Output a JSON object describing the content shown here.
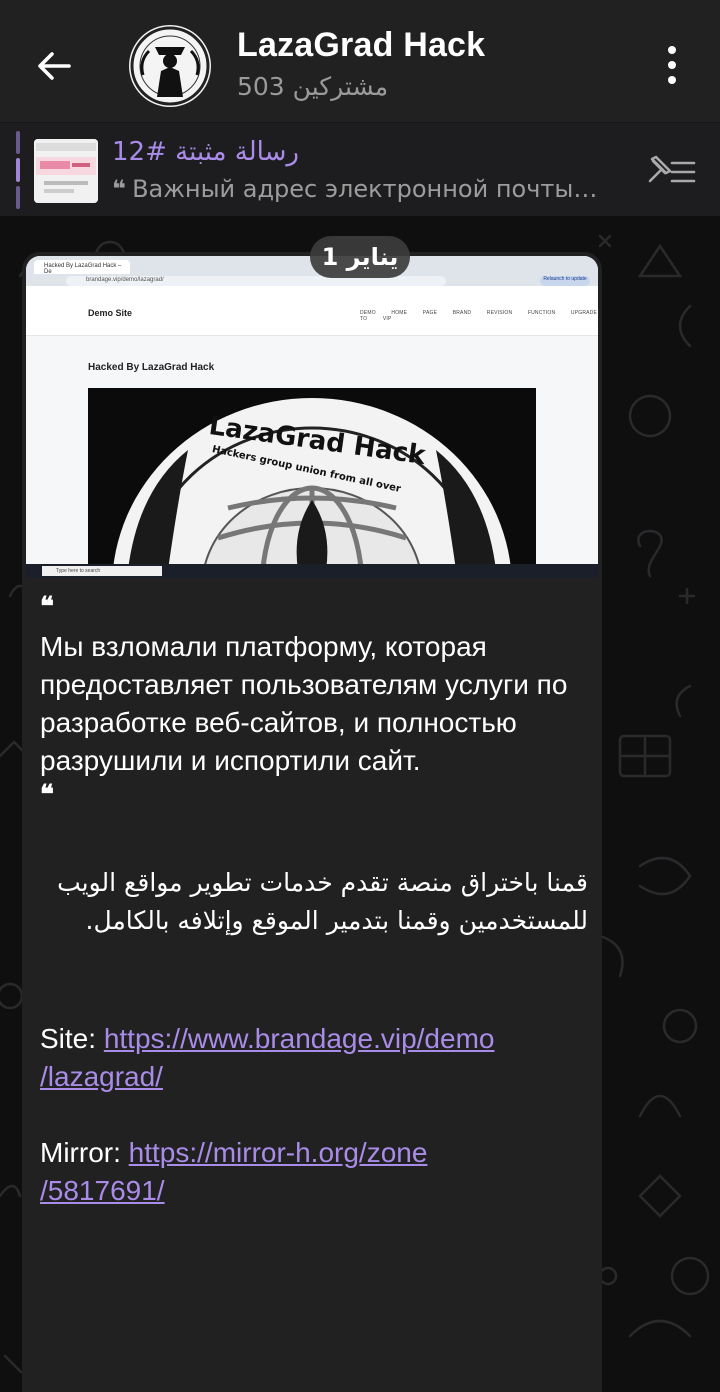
{
  "header": {
    "title": "LazaGrad Hack",
    "subscribers": "503 مشتركين"
  },
  "pinned": {
    "title": "رسالة مثبتة #12",
    "preview": "Важный адрес электронной почты…"
  },
  "date_pill": "1 يناير",
  "message": {
    "quote_open": "❝",
    "ru_text": "Мы взломали платформу, которая предоставляет пользователям услуги по разработке веб-сайтов, и полностью разрушили и испортили сайт.",
    "quote_close": "❝",
    "ar_text": "قمنا باختراق منصة تقدم خدمات تطوير مواقع الويب للمستخدمين وقمنا بتدمير الموقع وإتلافه بالكامل.",
    "site_label": "Site: ",
    "site_url_1": "https://www.brandage.vip/demo",
    "site_url_2": "/lazagrad/",
    "mirror_label": "Mirror: ",
    "mirror_url_1": "https://mirror-h.org/zone",
    "mirror_url_2": "/5817691/"
  },
  "screenshot": {
    "tab_title": "Hacked By LazaGrad Hack – De",
    "url": "brandage.vip/demo/lazagrad/",
    "update_button": "Relaunch to update",
    "brand": "Demo Site",
    "menu": "DEMO HOME PAGE BRAND REVISION FUNCTION UPGRADE TO VIP",
    "heading": "Hacked By LazaGrad Hack",
    "logo_text": "LazaGrad Hack",
    "logo_subtext": "Hackers group union from all over",
    "taskbar_search": "Type here to search"
  },
  "colors": {
    "accent": "#a98be8",
    "header_bg": "#212121",
    "bubble_bg": "#212121"
  },
  "icons": {
    "back": "arrow-left-icon",
    "menu": "more-vertical-icon",
    "pin_list": "pin-list-icon",
    "quote": "quote-icon"
  }
}
